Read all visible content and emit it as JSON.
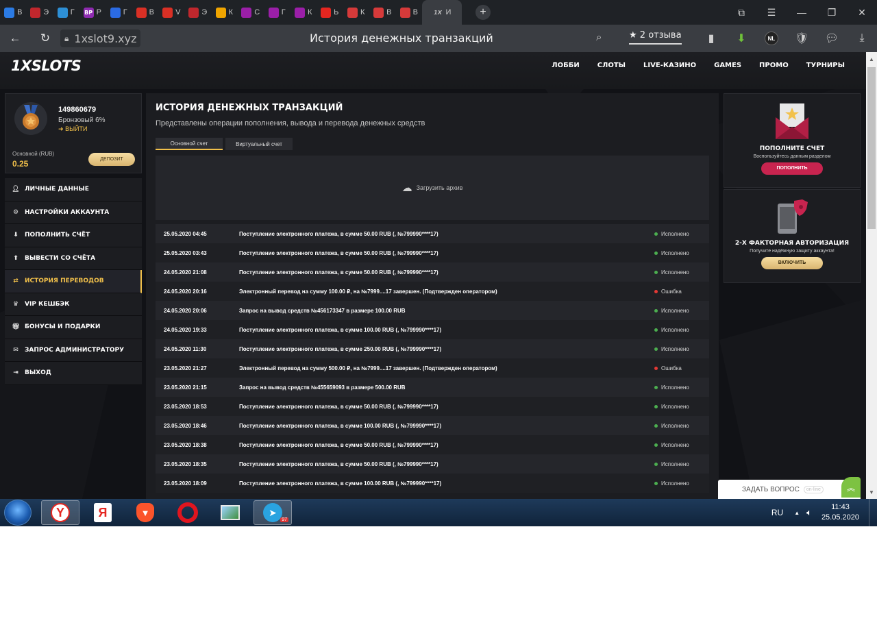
{
  "browser": {
    "tabs": [
      {
        "icon": "yandex-shield-icon",
        "letter": "В",
        "color": "#2b7be4"
      },
      {
        "icon": "casino-chip-icon",
        "letter": "Э",
        "color": "#c0272d"
      },
      {
        "icon": "grid-icon",
        "letter": "Г",
        "color": "#2d8fd5"
      },
      {
        "icon": "vp-icon",
        "letter": "Р",
        "color": "#8e2bb0",
        "badge": "ВР"
      },
      {
        "icon": "mail-icon",
        "letter": "Г",
        "color": "#2b6be4"
      },
      {
        "icon": "gmail-icon",
        "letter": "В",
        "color": "#d93025"
      },
      {
        "icon": "gmail-icon",
        "letter": "V",
        "color": "#d93025"
      },
      {
        "icon": "casino-chip-icon",
        "letter": "Э",
        "color": "#c0272d"
      },
      {
        "icon": "play-icon",
        "letter": "К",
        "color": "#f0a500"
      },
      {
        "icon": "w-icon",
        "letter": "С",
        "color": "#9b1fa8"
      },
      {
        "icon": "w-icon",
        "letter": "Г",
        "color": "#9b1fa8"
      },
      {
        "icon": "w-icon",
        "letter": "К",
        "color": "#9b1fa8"
      },
      {
        "icon": "yandex-icon",
        "letter": "Ь",
        "color": "#e52620"
      },
      {
        "icon": "circle-icon",
        "letter": "К",
        "color": "#d63a3a"
      },
      {
        "icon": "circle-icon",
        "letter": "В",
        "color": "#d63a3a"
      },
      {
        "icon": "circle-icon",
        "letter": "В",
        "color": "#d63a3a"
      }
    ],
    "active_tab": {
      "icon": "1x-icon",
      "letter": "И"
    },
    "url": "1xslot9.xyz",
    "page_title": "История денежных транзакций",
    "reviews": "2 отзыва"
  },
  "site": {
    "logo": "1XSLOTS",
    "nav": [
      "ЛОББИ",
      "СЛОТЫ",
      "LIVE-КАЗИНО",
      "GAMES",
      "ПРОМО",
      "ТУРНИРЫ"
    ]
  },
  "profile": {
    "user_id": "149860679",
    "level": "Бронзовый 6%",
    "logout": "ВЫЙТИ",
    "balance_label": "Основной (RUB)",
    "balance": "0.25",
    "deposit": "ДЕПОЗИТ"
  },
  "menu": [
    {
      "label": "ЛИЧНЫЕ ДАННЫЕ",
      "icon": "user-icon"
    },
    {
      "label": "НАСТРОЙКИ АККАУНТА",
      "icon": "settings-icon"
    },
    {
      "label": "ПОПОЛНИТЬ СЧЁТ",
      "icon": "download-icon"
    },
    {
      "label": "ВЫВЕСТИ СО СЧЁТА",
      "icon": "upload-icon"
    },
    {
      "label": "ИСТОРИЯ ПЕРЕВОДОВ",
      "icon": "transfer-icon",
      "active": true
    },
    {
      "label": "VIP КЕШБЭК",
      "icon": "crown-icon"
    },
    {
      "label": "БОНУСЫ И ПОДАРКИ",
      "icon": "gift-icon"
    },
    {
      "label": "ЗАПРОС АДМИНИСТРАТОРУ",
      "icon": "envelope-icon"
    },
    {
      "label": "ВЫХОД",
      "icon": "exit-icon"
    }
  ],
  "history": {
    "title": "ИСТОРИЯ ДЕНЕЖНЫХ ТРАНЗАКЦИЙ",
    "subtitle": "Представлены операции пополнения, вывода и перевода денежных средств",
    "tabs": [
      "Основной счет",
      "Виртуальный счет"
    ],
    "archive": "Загрузить архив",
    "rows": [
      {
        "date": "25.05.2020 04:45",
        "desc": "Поступление электронного платежа, в сумме 50.00 RUB (, №799990****17)",
        "status": "Исполнено",
        "ok": true
      },
      {
        "date": "25.05.2020 03:43",
        "desc": "Поступление электронного платежа, в сумме 50.00 RUB (, №799990****17)",
        "status": "Исполнено",
        "ok": true
      },
      {
        "date": "24.05.2020 21:08",
        "desc": "Поступление электронного платежа, в сумме 50.00 RUB (, №799990****17)",
        "status": "Исполнено",
        "ok": true
      },
      {
        "date": "24.05.2020 20:16",
        "desc": "Электронный перевод на сумму 100.00 ₽, на №7999....17 завершен. (Подтвержден оператором)",
        "status": "Ошибка",
        "ok": false
      },
      {
        "date": "24.05.2020 20:06",
        "desc": "Запрос на вывод средств №456173347 в размере 100.00 RUB",
        "status": "Исполнено",
        "ok": true
      },
      {
        "date": "24.05.2020 19:33",
        "desc": "Поступление электронного платежа, в сумме 100.00 RUB (, №799990****17)",
        "status": "Исполнено",
        "ok": true
      },
      {
        "date": "24.05.2020 11:30",
        "desc": "Поступление электронного платежа, в сумме 250.00 RUB (, №799990****17)",
        "status": "Исполнено",
        "ok": true
      },
      {
        "date": "23.05.2020 21:27",
        "desc": "Электронный перевод на сумму 500.00 ₽, на №7999....17 завершен. (Подтвержден оператором)",
        "status": "Ошибка",
        "ok": false
      },
      {
        "date": "23.05.2020 21:15",
        "desc": "Запрос на вывод средств №455659093 в размере 500.00 RUB",
        "status": "Исполнено",
        "ok": true
      },
      {
        "date": "23.05.2020 18:53",
        "desc": "Поступление электронного платежа, в сумме 50.00 RUB (, №799990****17)",
        "status": "Исполнено",
        "ok": true
      },
      {
        "date": "23.05.2020 18:46",
        "desc": "Поступление электронного платежа, в сумме 100.00 RUB (, №799990****17)",
        "status": "Исполнено",
        "ok": true
      },
      {
        "date": "23.05.2020 18:38",
        "desc": "Поступление электронного платежа, в сумме 50.00 RUB (, №799990****17)",
        "status": "Исполнено",
        "ok": true
      },
      {
        "date": "23.05.2020 18:35",
        "desc": "Поступление электронного платежа, в сумме 50.00 RUB (, №799990****17)",
        "status": "Исполнено",
        "ok": true
      },
      {
        "date": "23.05.2020 18:09",
        "desc": "Поступление электронного платежа, в сумме 100.00 RUB (, №799990****17)",
        "status": "Исполнено",
        "ok": true
      }
    ]
  },
  "promo_deposit": {
    "title": "ПОПОЛНИТЕ СЧЕТ",
    "text": "Воспользуйтесь данным разделом",
    "button": "ПОПОЛНИТЬ"
  },
  "promo_2fa": {
    "title": "2-Х ФАКТОРНАЯ АВТОРИЗАЦИЯ",
    "text": "Получите надёжную защиту аккаунта!",
    "button": "ВКЛЮЧИТЬ"
  },
  "chat": {
    "label": "ЗАДАТЬ ВОПРОС",
    "status": "on-line"
  },
  "taskbar": {
    "language": "RU",
    "time": "11:43",
    "date": "25.05.2020",
    "telegram_badge": "97"
  },
  "colors": {
    "accent_gold": "#f2c14b",
    "status_ok": "#4caf50",
    "status_error": "#e53935",
    "brand_red": "#c8244f"
  }
}
